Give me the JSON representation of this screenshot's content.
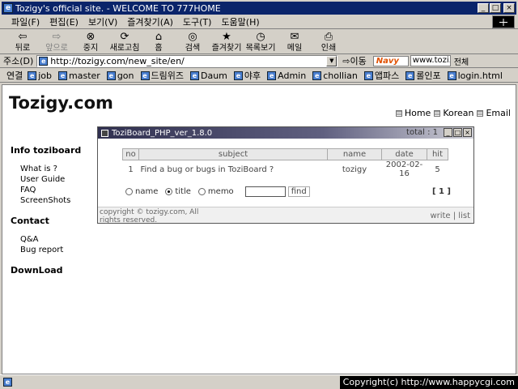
{
  "window": {
    "title": "Tozigy's official site. - WELCOME TO 777HOME",
    "controls": [
      "_",
      "□",
      "×"
    ]
  },
  "menu": [
    "파일(F)",
    "편집(E)",
    "보기(V)",
    "즐겨찾기(A)",
    "도구(T)",
    "도움말(H)"
  ],
  "toolbar": [
    {
      "label": "뒤로",
      "icon": "back-arrow-icon",
      "glyph": "⇦",
      "disabled": false
    },
    {
      "label": "앞으로",
      "icon": "forward-arrow-icon",
      "glyph": "⇨",
      "disabled": true
    },
    {
      "label": "중지",
      "icon": "stop-icon",
      "glyph": "⊗",
      "disabled": false
    },
    {
      "label": "새로고침",
      "icon": "refresh-icon",
      "glyph": "⟳",
      "disabled": false
    },
    {
      "label": "홈",
      "icon": "home-icon",
      "glyph": "⌂",
      "disabled": false
    },
    {
      "label": "검색",
      "icon": "search-icon",
      "glyph": "◎",
      "disabled": false
    },
    {
      "label": "즐겨찾기",
      "icon": "favorites-icon",
      "glyph": "★",
      "disabled": false
    },
    {
      "label": "목록보기",
      "icon": "history-icon",
      "glyph": "◷",
      "disabled": false
    },
    {
      "label": "메일",
      "icon": "mail-icon",
      "glyph": "✉",
      "disabled": false
    },
    {
      "label": "인쇄",
      "icon": "print-icon",
      "glyph": "⎙",
      "disabled": false
    }
  ],
  "address": {
    "label": "주소(D)",
    "url": "http://tozigy.com/new_site/en/",
    "go": "이동",
    "navy_brand": "Navy",
    "navy_field": "www.tozi..",
    "navy_all": "전체"
  },
  "links": {
    "label": "연결",
    "items": [
      "job",
      "master",
      "gon",
      "드림위즈",
      "Daum",
      "야후",
      "Admin",
      "chollian",
      "앱파스",
      "롤인포",
      "login.html"
    ]
  },
  "page": {
    "logo": "Tozigy.com",
    "topnav": [
      "Home",
      "Korean",
      "Email"
    ],
    "sidebar": {
      "info_heading": "Info toziboard",
      "info_links": [
        "What is ?",
        "User Guide",
        "FAQ",
        "ScreenShots"
      ],
      "contact_heading": "Contact",
      "contact_links": [
        "Q&A",
        "Bug report"
      ],
      "download_heading": "DownLoad"
    },
    "board": {
      "title": "ToziBoard_PHP_ver_1.8.0",
      "total": "total : 1",
      "columns": [
        "no",
        "subject",
        "name",
        "date",
        "hit"
      ],
      "rows": [
        {
          "no": "1",
          "subject": "Find a bug or bugs in ToziBoard ?",
          "name": "tozigy",
          "date": "2002-02-16",
          "hit": "5"
        }
      ],
      "search_options": [
        "name",
        "title",
        "memo"
      ],
      "search_selected": "title",
      "find": "find",
      "pages": "[ 1 ]",
      "copyright": "copyright © tozigy.com, All rights reserved.",
      "actions": "write | list"
    }
  },
  "status": {
    "copyright": "Copyright(c) http://www.happycgi.com"
  }
}
